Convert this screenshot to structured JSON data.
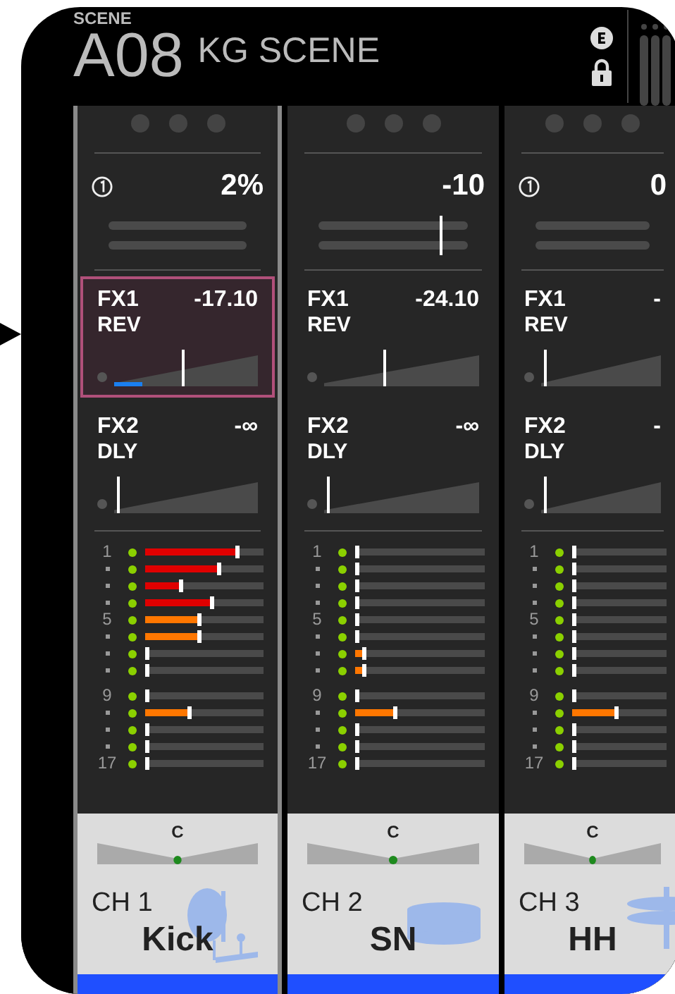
{
  "header": {
    "scene_label": "SCENE",
    "scene_number": "A08",
    "scene_name": "KG SCENE"
  },
  "channels": [
    {
      "selected": true,
      "has_icon": true,
      "value": "2%",
      "fx": [
        {
          "bus": "FX1",
          "type": "REV",
          "value": "-17.10",
          "level": 0.47,
          "selected": true
        },
        {
          "bus": "FX2",
          "type": "DLY",
          "value": "-∞",
          "level": 0.02,
          "selected": false
        }
      ],
      "meters": [
        {
          "label": "1",
          "level": 0.76,
          "color": "#e00000"
        },
        {
          "level": 0.61,
          "color": "#e00000"
        },
        {
          "level": 0.29,
          "color": "#e00000"
        },
        {
          "level": 0.55,
          "color": "#e00000"
        },
        {
          "label": "5",
          "level": 0.44,
          "color": "#ff7700"
        },
        {
          "level": 0.44,
          "color": "#ff7700"
        },
        {
          "level": 0
        },
        {
          "level": 0
        },
        {
          "label": "9",
          "level": 0
        },
        {
          "level": 0.36,
          "color": "#ff7700"
        },
        {
          "level": 0
        },
        {
          "level": 0
        },
        {
          "label": "17",
          "level": 0
        }
      ],
      "pan": "C",
      "number": "CH 1",
      "name": "Kick",
      "kind": "kick"
    },
    {
      "selected": false,
      "has_icon": false,
      "value": "-10",
      "level": 0.81,
      "fx": [
        {
          "bus": "FX1",
          "type": "REV",
          "value": "-24.10",
          "level": 0.38,
          "selected": false
        },
        {
          "bus": "FX2",
          "type": "DLY",
          "value": "-∞",
          "level": 0.02,
          "selected": false
        }
      ],
      "meters": [
        {
          "label": "1",
          "level": 0
        },
        {
          "level": 0
        },
        {
          "level": 0
        },
        {
          "level": 0
        },
        {
          "label": "5",
          "level": 0
        },
        {
          "level": 0
        },
        {
          "level": 0.05,
          "color": "#ff7700"
        },
        {
          "level": 0.05,
          "color": "#ff7700"
        },
        {
          "label": "9",
          "level": 0
        },
        {
          "level": 0.29,
          "color": "#ff7700"
        },
        {
          "level": 0
        },
        {
          "level": 0
        },
        {
          "label": "17",
          "level": 0
        }
      ],
      "pan": "C",
      "number": "CH 2",
      "name": "SN",
      "kind": "snare"
    },
    {
      "selected": false,
      "has_icon": true,
      "value": "0",
      "fx": [
        {
          "bus": "FX1",
          "type": "REV",
          "value": "-",
          "level": 0.02,
          "selected": false
        },
        {
          "bus": "FX2",
          "type": "DLY",
          "value": "-",
          "level": 0.02,
          "selected": false
        }
      ],
      "meters": [
        {
          "label": "1",
          "level": 0
        },
        {
          "level": 0
        },
        {
          "level": 0
        },
        {
          "level": 0
        },
        {
          "label": "5",
          "level": 0
        },
        {
          "level": 0
        },
        {
          "level": 0
        },
        {
          "level": 0
        },
        {
          "label": "9",
          "level": 0
        },
        {
          "level": 0.45,
          "color": "#ff7700"
        },
        {
          "level": 0
        },
        {
          "level": 0
        },
        {
          "label": "17",
          "level": 0
        }
      ],
      "pan": "C",
      "number": "CH 3",
      "name": "HH",
      "kind": "cymbal"
    }
  ]
}
